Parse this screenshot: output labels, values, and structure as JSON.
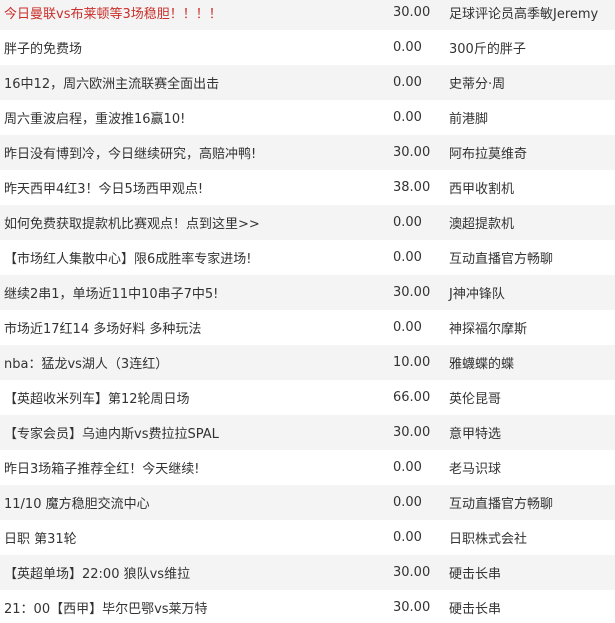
{
  "tips": [
    {
      "title": "今日曼联vs布莱顿等3场稳胆！！！！",
      "price": "30.00",
      "author": "足球评论员高季敏Jeremy"
    },
    {
      "title": "胖子的免费场",
      "price": "0.00",
      "author": "300斤的胖子"
    },
    {
      "title": "16中12，周六欧洲主流联赛全面出击",
      "price": "0.00",
      "author": "史蒂分·周"
    },
    {
      "title": "周六重波启程，重波推16赢10!",
      "price": "0.00",
      "author": "前港脚"
    },
    {
      "title": "昨日没有博到冷，今日继续研究，高赔冲鸭!",
      "price": "30.00",
      "author": "阿布拉莫维奇"
    },
    {
      "title": "昨天西甲4红3！今日5场西甲观点!",
      "price": "38.00",
      "author": "西甲收割机"
    },
    {
      "title": "如何免费获取提款机比赛观点！点到这里>>",
      "price": "0.00",
      "author": "澳超提款机"
    },
    {
      "title": "【市场红人集散中心】限6成胜率专家进场!",
      "price": "0.00",
      "author": "互动直播官方畅聊"
    },
    {
      "title": "继续2串1，单场近11中10串子7中5!",
      "price": "30.00",
      "author": "J神冲锋队"
    },
    {
      "title": "市场近17红14 多场好料 多种玩法",
      "price": "0.00",
      "author": "神探福尔摩斯"
    },
    {
      "title": "nba：猛龙vs湖人（3连红）",
      "price": "10.00",
      "author": "雅蠛蝶的蝶"
    },
    {
      "title": "【英超收米列车】第12轮周日场",
      "price": "66.00",
      "author": "英伦昆哥"
    },
    {
      "title": "【专家会员】乌迪内斯vs费拉拉SPAL",
      "price": "30.00",
      "author": "意甲特选"
    },
    {
      "title": "昨日3场箱子推荐全红！今天继续!",
      "price": "0.00",
      "author": "老马识球"
    },
    {
      "title": "11/10 魔方稳胆交流中心",
      "price": "0.00",
      "author": "互动直播官方畅聊"
    },
    {
      "title": "日职 第31轮",
      "price": "0.00",
      "author": "日职株式会社"
    },
    {
      "title": "【英超单场】22:00 狼队vs维拉",
      "price": "30.00",
      "author": "硬击长串"
    },
    {
      "title": "21：00【西甲】毕尔巴鄂vs莱万特",
      "price": "30.00",
      "author": "硬击长串"
    }
  ]
}
